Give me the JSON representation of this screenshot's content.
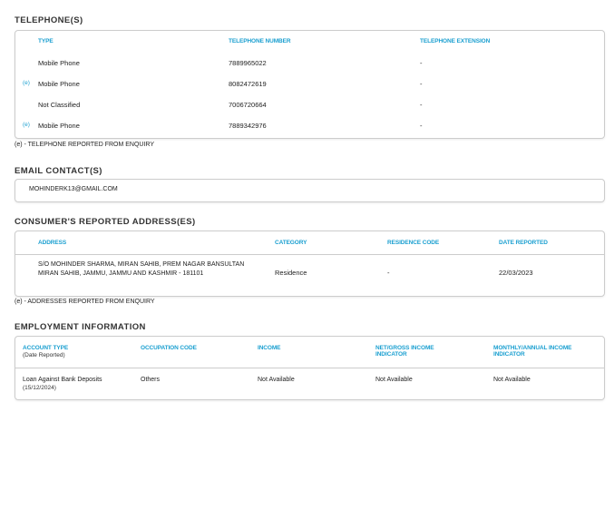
{
  "telephones": {
    "title": "TELEPHONE(S)",
    "headers": [
      "TYPE",
      "TELEPHONE NUMBER",
      "TELEPHONE EXTENSION"
    ],
    "rows": [
      {
        "flag": "",
        "type": "Mobile Phone",
        "number": "7889965022",
        "ext": "-"
      },
      {
        "flag": "(e)",
        "type": "Mobile Phone",
        "number": "8082472619",
        "ext": "-"
      },
      {
        "flag": "",
        "type": "Not Classified",
        "number": "7006720664",
        "ext": "-"
      },
      {
        "flag": "(e)",
        "type": "Mobile Phone",
        "number": "7889342976",
        "ext": "-"
      }
    ],
    "note": "(e) - TELEPHONE REPORTED FROM ENQUIRY"
  },
  "email": {
    "title": "EMAIL CONTACT(S)",
    "value": "MOHINDERK13@GMAIL.COM"
  },
  "addresses": {
    "title": "CONSUMER'S REPORTED ADDRESS(ES)",
    "headers": [
      "ADDRESS",
      "CATEGORY",
      "RESIDENCE CODE",
      "DATE REPORTED"
    ],
    "rows": [
      {
        "address": "S/O MOHINDER SHARMA, MIRAN SAHIB, PREM NAGAR BANSULTAN MIRAN SAHIB, JAMMU, JAMMU AND KASHMIR - 181101",
        "category": "Residence",
        "residence_code": "-",
        "date": "22/03/2023"
      }
    ],
    "note": "(e) - ADDRESSES REPORTED FROM ENQUIRY"
  },
  "employment": {
    "title": "EMPLOYMENT INFORMATION",
    "headers": [
      "ACCOUNT TYPE",
      "OCCUPATION CODE",
      "INCOME",
      "NET/GROSS INCOME INDICATOR",
      "MONTHLY/ANNUAL INCOME INDICATOR"
    ],
    "header_sub": "(Date Reported)",
    "rows": [
      {
        "account_type": "Loan Against Bank Deposits",
        "date": "(15/12/2024)",
        "occupation": "Others",
        "income": "Not Available",
        "net_gross": "Not Available",
        "monthly_annual": "Not Available"
      }
    ]
  }
}
